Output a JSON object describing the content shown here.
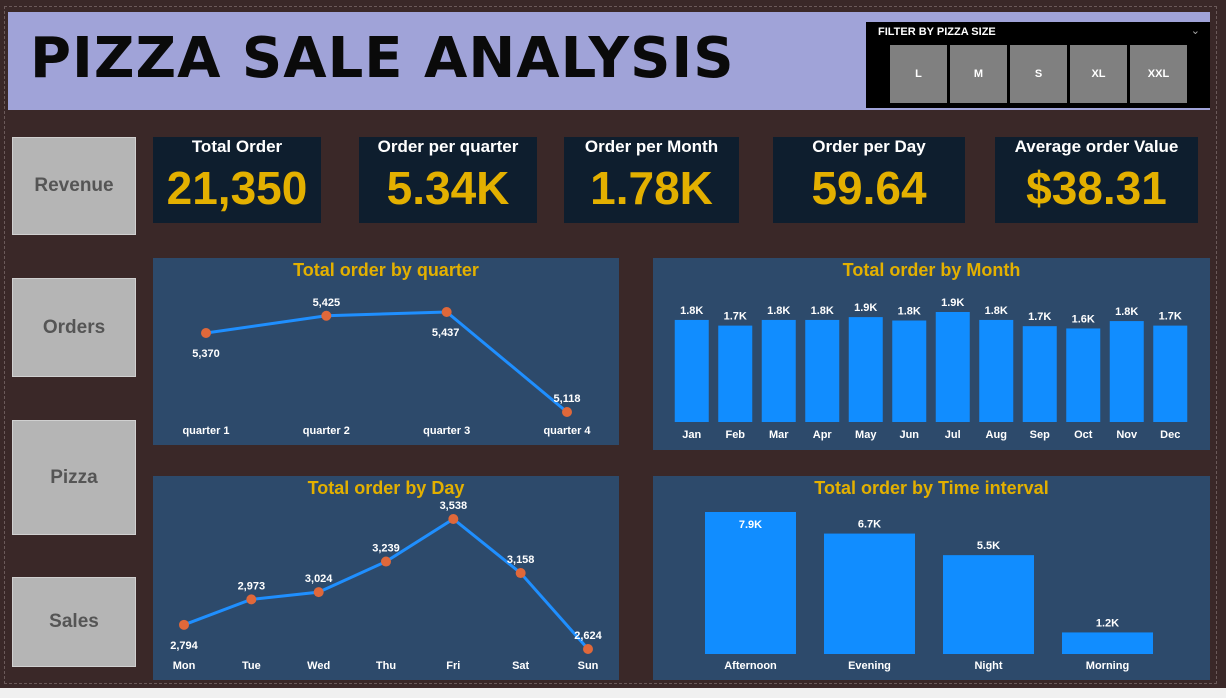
{
  "title": "PIZZA SALE ANALYSIS",
  "filter": {
    "title": "FILTER BY PIZZA SIZE",
    "chevron": "⌄",
    "sizes": [
      "L",
      "M",
      "S",
      "XL",
      "XXL"
    ]
  },
  "nav": {
    "revenue": "Revenue",
    "orders": "Orders",
    "pizza": "Pizza",
    "sales": "Sales"
  },
  "kpis": [
    {
      "label": "Total Order",
      "value": "21,350"
    },
    {
      "label": "Order per quarter",
      "value": "5.34K"
    },
    {
      "label": "Order per Month",
      "value": "1.78K"
    },
    {
      "label": "Order per Day",
      "value": "59.64"
    },
    {
      "label": "Average order Value",
      "value": "$38.31"
    }
  ],
  "colors": {
    "accent": "#e3b000",
    "bar": "#118dff",
    "line": "#1f8fff",
    "marker": "#e0683a",
    "panel": "#2d4a6b"
  },
  "chart_data": [
    {
      "type": "line",
      "title": "Total order by quarter",
      "categories": [
        "quarter 1",
        "quarter 2",
        "quarter 3",
        "quarter 4"
      ],
      "values": [
        5370,
        5425,
        5437,
        5118
      ],
      "labels": [
        "5,370",
        "5,425",
        "5,437",
        "5,118"
      ]
    },
    {
      "type": "bar",
      "title": "Total order by Month",
      "categories": [
        "Jan",
        "Feb",
        "Mar",
        "Apr",
        "May",
        "Jun",
        "Jul",
        "Aug",
        "Sep",
        "Oct",
        "Nov",
        "Dec"
      ],
      "values": [
        1800,
        1700,
        1800,
        1800,
        1850,
        1790,
        1940,
        1800,
        1690,
        1650,
        1780,
        1700
      ],
      "labels": [
        "1.8K",
        "1.7K",
        "1.8K",
        "1.8K",
        "1.9K",
        "1.8K",
        "1.9K",
        "1.8K",
        "1.7K",
        "1.6K",
        "1.8K",
        "1.7K"
      ]
    },
    {
      "type": "line",
      "title": "Total order by Day",
      "categories": [
        "Mon",
        "Tue",
        "Wed",
        "Thu",
        "Fri",
        "Sat",
        "Sun"
      ],
      "values": [
        2794,
        2973,
        3024,
        3239,
        3538,
        3158,
        2624
      ],
      "labels": [
        "2,794",
        "2,973",
        "3,024",
        "3,239",
        "3,538",
        "3,158",
        "2,624"
      ]
    },
    {
      "type": "bar",
      "title": "Total order by Time interval",
      "categories": [
        "Afternoon",
        "Evening",
        "Night",
        "Morning"
      ],
      "values": [
        7900,
        6700,
        5500,
        1200
      ],
      "labels": [
        "7.9K",
        "6.7K",
        "5.5K",
        "1.2K"
      ]
    }
  ]
}
